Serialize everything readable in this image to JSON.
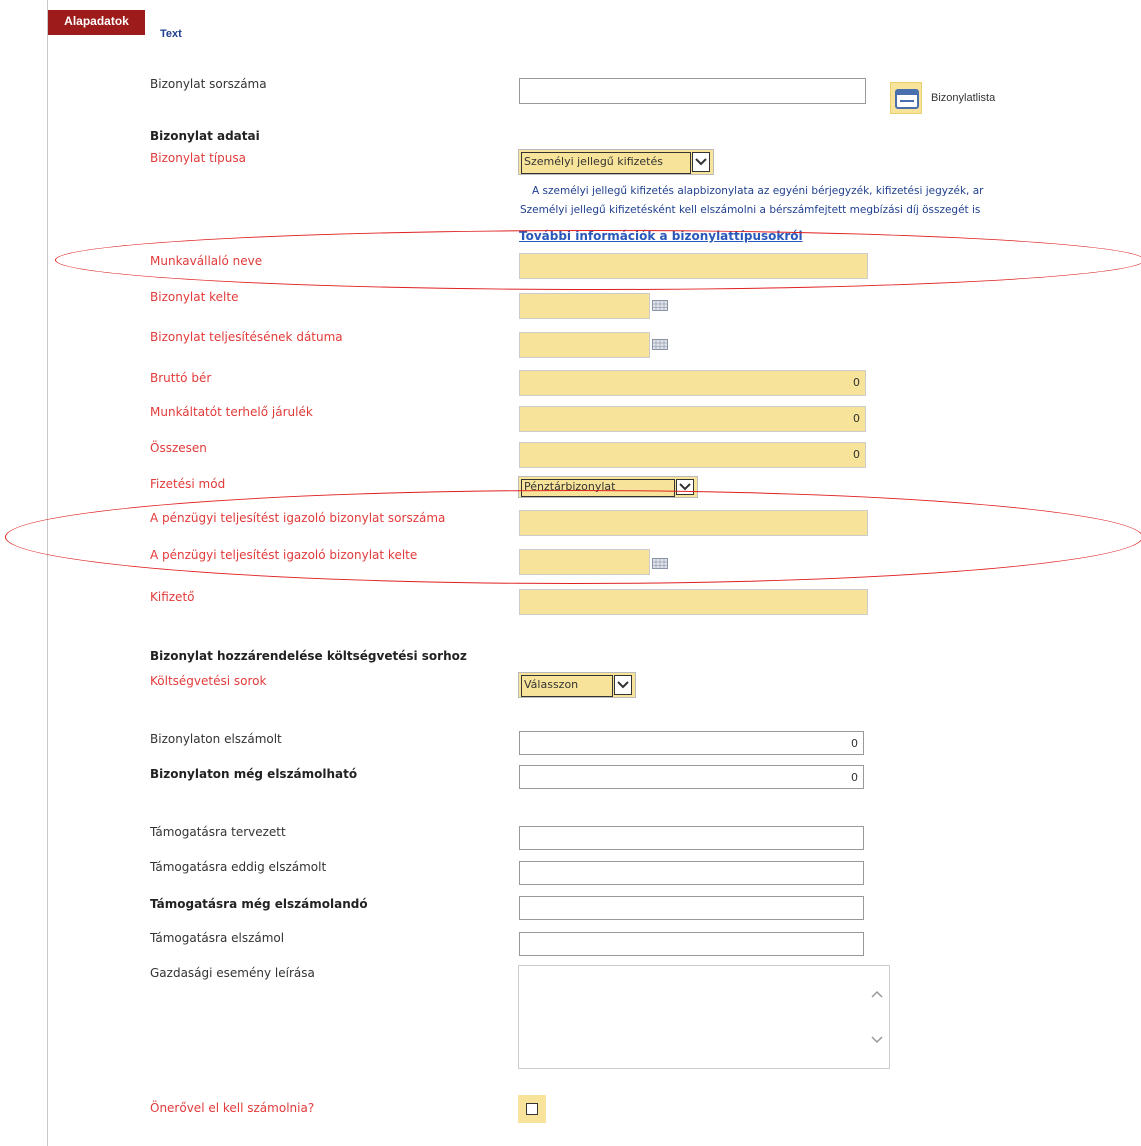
{
  "tabs": {
    "active": "Alapadatok",
    "other": "Text"
  },
  "doc_number": {
    "label": "Bizonylat sorszáma",
    "value": ""
  },
  "list_button": {
    "label": "Bizonylatlista",
    "icon": "list-window-icon"
  },
  "section_doc": {
    "title": "Bizonylat adatai"
  },
  "doc_type": {
    "label": "Bizonylat típusa",
    "selected": "Személyi jellegű kifizetés",
    "info_line1": "A személyi jellegű kifizetés alapbizonylata az egyéni bérjegyzék, kifizetési jegyzék, ar",
    "info_line2": "Személyi jellegű kifizetésként kell elszámolni a bérszámfejtett megbízási díj összegét is",
    "info_link": "További információk a bizonylattípusokról"
  },
  "employee_name": {
    "label": "Munkavállaló neve",
    "value": ""
  },
  "doc_date": {
    "label": "Bizonylat kelte",
    "value": ""
  },
  "fulfil_date": {
    "label": "Bizonylat teljesítésének dátuma",
    "value": ""
  },
  "gross_wage": {
    "label": "Bruttó bér",
    "value": "0"
  },
  "employer_contrib": {
    "label": "Munkáltatót terhelő járulék",
    "value": "0"
  },
  "total": {
    "label": "Összesen",
    "value": "0"
  },
  "payment_method": {
    "label": "Fizetési mód",
    "selected": "Pénztárbizonylat"
  },
  "fin_doc_number": {
    "label": "A pénzügyi teljesítést igazoló bizonylat sorszáma",
    "value": ""
  },
  "fin_doc_date": {
    "label": "A pénzügyi teljesítést igazoló bizonylat kelte",
    "value": ""
  },
  "payer": {
    "label": "Kifizető",
    "value": ""
  },
  "section_budget": {
    "title": "Bizonylat hozzárendelése költségvetési sorhoz"
  },
  "budget_lines": {
    "label": "Költségvetési sorok",
    "selected": "Válasszon"
  },
  "settled_on_doc": {
    "label": "Bizonylaton elszámolt",
    "value": "0"
  },
  "still_settleable": {
    "label": "Bizonylaton még elszámolható",
    "value": "0"
  },
  "planned_support": {
    "label": "Támogatásra tervezett",
    "value": ""
  },
  "settled_support": {
    "label": "Támogatásra eddig elszámolt",
    "value": ""
  },
  "remaining_support": {
    "label": "Támogatásra még elszámolandó",
    "value": ""
  },
  "support_settles": {
    "label": "Támogatásra elszámol",
    "value": ""
  },
  "event_description": {
    "label": "Gazdasági esemény leírása",
    "value": ""
  },
  "own_contribution": {
    "label": "Önerővel el kell számolnia?",
    "checked": false
  },
  "colors": {
    "tab_active": "#9e1b1b",
    "required_label": "#e23a3a",
    "field_yellow": "#f7e399",
    "link": "#2a58b8",
    "annotation": "#e02020"
  }
}
